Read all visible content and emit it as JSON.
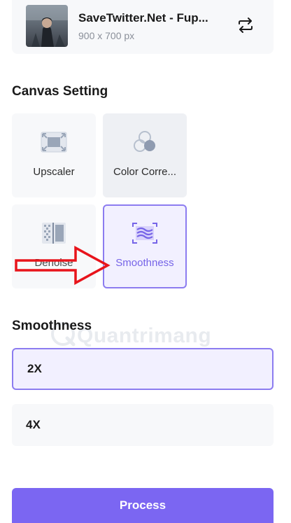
{
  "file": {
    "name": "SaveTwitter.Net - Fup...",
    "size": "900 x 700 px"
  },
  "canvas_setting": {
    "title": "Canvas Setting",
    "tiles": [
      {
        "label": "Upscaler",
        "icon": "upscaler-icon"
      },
      {
        "label": "Color Corre...",
        "icon": "color-correction-icon"
      },
      {
        "label": "Denoise",
        "icon": "denoise-icon"
      },
      {
        "label": "Smoothness",
        "icon": "smoothness-icon",
        "selected": true
      }
    ]
  },
  "smoothness": {
    "title": "Smoothness",
    "options": [
      {
        "label": "2X",
        "selected": true
      },
      {
        "label": "4X",
        "selected": false
      }
    ]
  },
  "process_button": {
    "label": "Process"
  },
  "watermark": {
    "text": "Quantrimang"
  },
  "colors": {
    "accent": "#7b66f2",
    "selected_border": "#8c7cf0",
    "selected_bg": "#f2f0ff",
    "tile_bg": "#f7f8fa",
    "annotation_arrow": "#e8141b"
  }
}
